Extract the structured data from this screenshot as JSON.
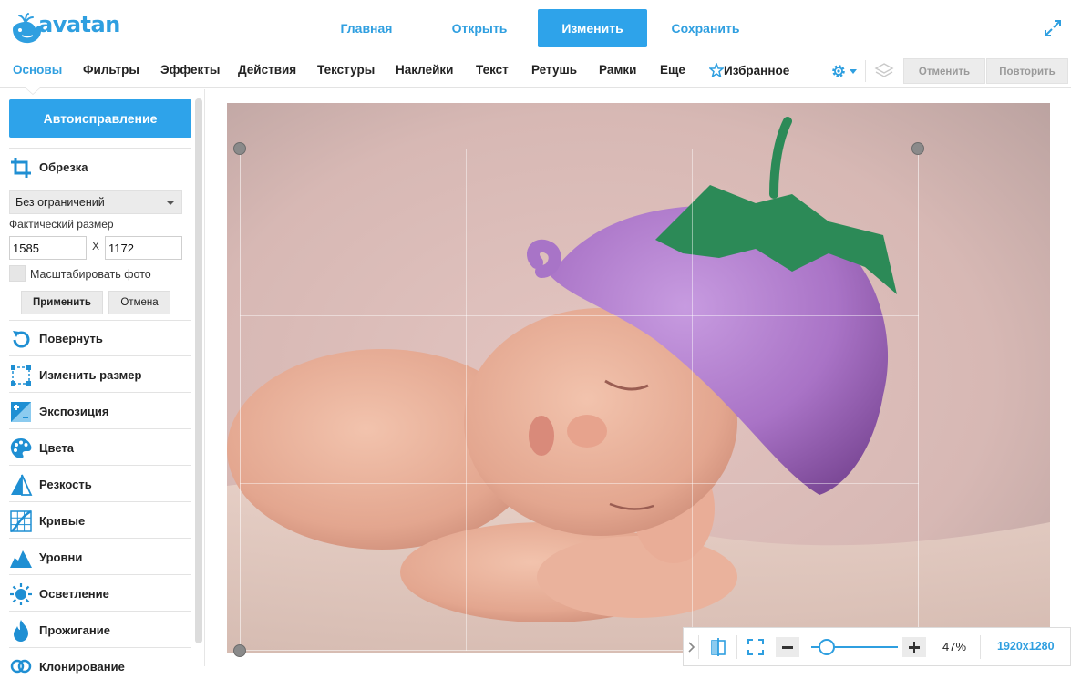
{
  "app": {
    "logo_text": "avatan",
    "accent_color": "#2ea3ea"
  },
  "top_nav": {
    "items": [
      {
        "label": "Главная",
        "active": false
      },
      {
        "label": "Открыть",
        "active": false
      },
      {
        "label": "Изменить",
        "active": true
      },
      {
        "label": "Сохранить",
        "active": false
      }
    ],
    "expand_icon": "expand-arrows-icon"
  },
  "menu": {
    "items": [
      {
        "label": "Основы",
        "active": true
      },
      {
        "label": "Фильтры"
      },
      {
        "label": "Эффекты"
      },
      {
        "label": "Действия"
      },
      {
        "label": "Текстуры"
      },
      {
        "label": "Наклейки"
      },
      {
        "label": "Текст"
      },
      {
        "label": "Ретушь"
      },
      {
        "label": "Рамки"
      },
      {
        "label": "Еще"
      },
      {
        "label": "Избранное",
        "icon": "star-icon"
      }
    ],
    "settings_icon": "gear-icon",
    "layers_icon": "layers-icon",
    "undo_label": "Отменить",
    "redo_label": "Повторить"
  },
  "sidebar": {
    "auto_fix_label": "Автоисправление",
    "crop": {
      "label": "Обрезка",
      "icon": "crop-icon",
      "ratio_selected": "Без ограничений",
      "actual_size_label": "Фактический размер",
      "width": "1585",
      "height": "1172",
      "x_label": "X",
      "scale_label": "Масштабировать фото",
      "scale_checked": false,
      "apply_label": "Применить",
      "cancel_label": "Отмена"
    },
    "tools": [
      {
        "label": "Повернуть",
        "icon": "rotate-icon"
      },
      {
        "label": "Изменить размер",
        "icon": "resize-icon"
      },
      {
        "label": "Экспозиция",
        "icon": "exposure-icon"
      },
      {
        "label": "Цвета",
        "icon": "palette-icon"
      },
      {
        "label": "Резкость",
        "icon": "sharpness-icon"
      },
      {
        "label": "Кривые",
        "icon": "curves-icon"
      },
      {
        "label": "Уровни",
        "icon": "levels-icon"
      },
      {
        "label": "Осветление",
        "icon": "sun-icon"
      },
      {
        "label": "Прожигание",
        "icon": "flame-icon"
      },
      {
        "label": "Клонирование",
        "icon": "clone-icon"
      }
    ]
  },
  "canvas": {
    "photo_subject": "sleeping baby in purple felt hat"
  },
  "zoom_bar": {
    "zoom_percent": "47%",
    "zoom_fraction": 0.18,
    "image_size": "1920x1280",
    "collapse_icon": "chevron-right-icon",
    "compare_icon": "compare-icon",
    "fit_icon": "fit-screen-icon",
    "minus_icon": "minus-icon",
    "plus_icon": "plus-icon"
  }
}
